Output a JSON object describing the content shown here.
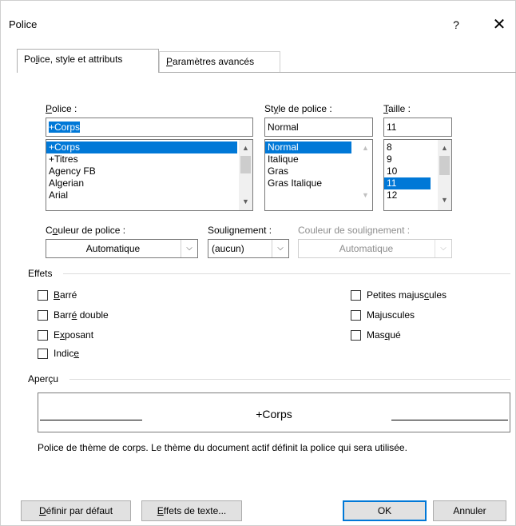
{
  "window": {
    "title": "Police",
    "help": "?",
    "close": "✕"
  },
  "tabs": [
    {
      "pre": "Po",
      "u": "l",
      "post": "ice, style et attributs"
    },
    {
      "pre": "",
      "u": "P",
      "post": "aramètres avancés"
    }
  ],
  "font": {
    "label": "Police :",
    "label_u": "P",
    "label_rest": "olice :",
    "value": "+Corps",
    "items": [
      "+Corps",
      "+Titres",
      "Agency FB",
      "Algerian",
      "Arial"
    ]
  },
  "style": {
    "label_pre": "St",
    "label_u": "y",
    "label_post": "le de police :",
    "value": "Normal",
    "items": [
      "Normal",
      "Italique",
      "Gras",
      "Gras Italique"
    ]
  },
  "size": {
    "label_u": "T",
    "label_post": "aille :",
    "value": "11",
    "items": [
      "8",
      "9",
      "10",
      "11",
      "12"
    ]
  },
  "color": {
    "label_pre": "C",
    "label_u": "o",
    "label_post": "uleur de police :",
    "value": "Automatique"
  },
  "underline": {
    "label_pre": "Souli",
    "label_u": "g",
    "label_post": "nement :",
    "value": "(aucun)"
  },
  "underline_color": {
    "label": "Couleur de soulignement :",
    "value": "Automatique"
  },
  "effects": {
    "title": "Effets",
    "left": [
      {
        "pre": "",
        "u": "B",
        "post": "arré"
      },
      {
        "pre": "Barr",
        "u": "é",
        "post": " double"
      },
      {
        "pre": "E",
        "u": "x",
        "post": "posant"
      },
      {
        "pre": "Indic",
        "u": "e",
        "post": ""
      }
    ],
    "right": [
      {
        "pre": "Petites majus",
        "u": "c",
        "post": "ules"
      },
      {
        "pre": "Ma",
        "u": "j",
        "post": "uscules"
      },
      {
        "pre": "Mas",
        "u": "q",
        "post": "ué"
      }
    ]
  },
  "preview": {
    "title": "Aperçu",
    "sample": "+Corps",
    "description": "Police de thème de corps. Le thème du document actif définit la police qui sera utilisée."
  },
  "buttons": {
    "default": {
      "u": "D",
      "post": "éfinir par défaut"
    },
    "text_effects": {
      "u": "E",
      "post": "ffets de texte..."
    },
    "ok": "OK",
    "cancel": "Annuler"
  },
  "colors": {
    "selection": "#0078d7",
    "default_button_border": "#0078d7"
  }
}
